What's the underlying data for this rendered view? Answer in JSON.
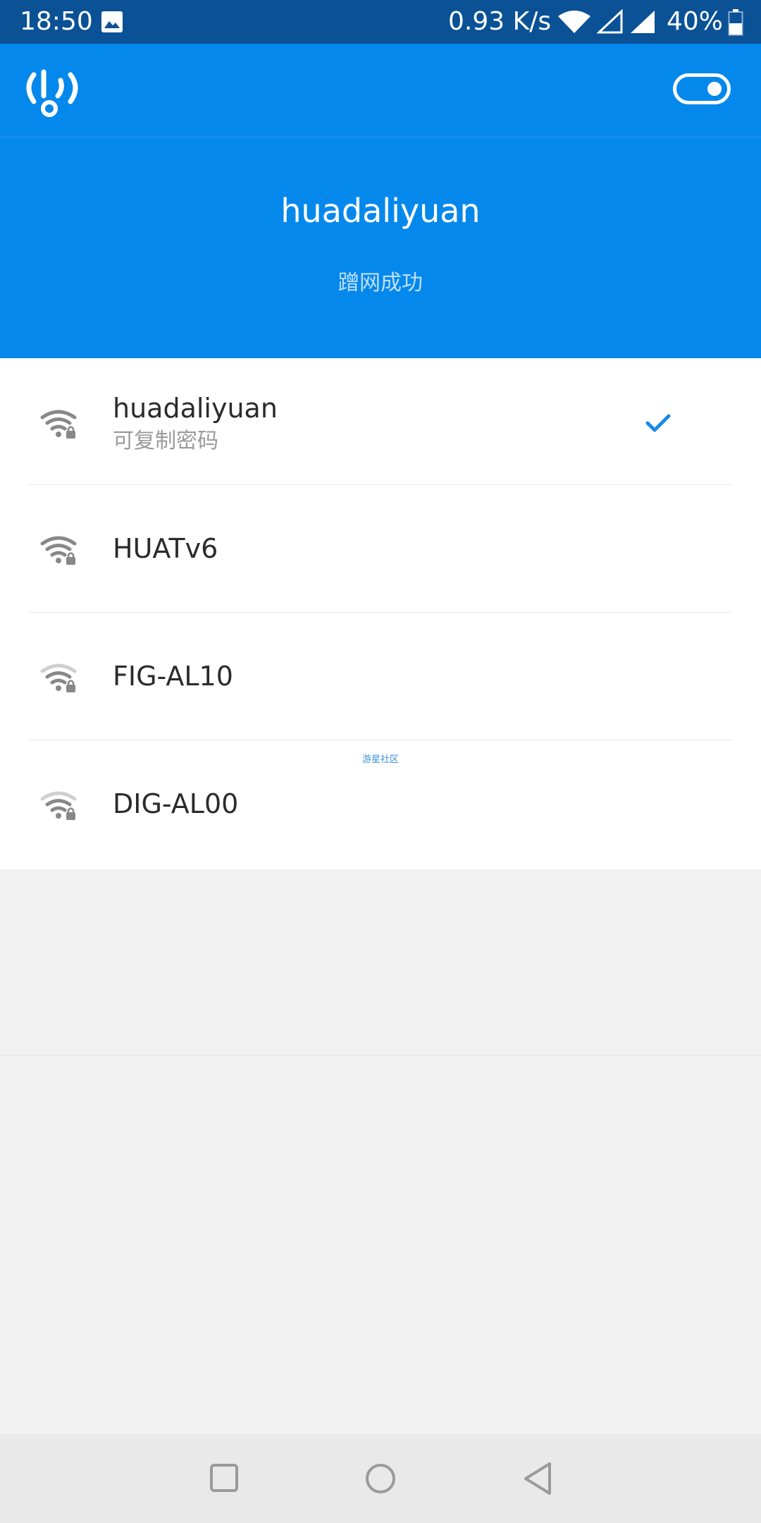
{
  "status_bar": {
    "time": "18:50",
    "net_speed": "0.93 K/s",
    "battery": "40%",
    "icons": [
      "image-icon",
      "wifi-icon",
      "cell-signal-icon",
      "cell-signal-icon",
      "battery-icon"
    ]
  },
  "header": {
    "logo_icon": "wifi-key-logo-icon",
    "toggle_icon": "toggle-icon",
    "connected_ssid": "huadaliyuan",
    "connected_status": "蹭网成功"
  },
  "networks": [
    {
      "ssid": "huadaliyuan",
      "sub": "可复制密码",
      "connected": true
    },
    {
      "ssid": "HUATv6"
    },
    {
      "ssid": "FIG-AL10"
    },
    {
      "ssid": "DIG-AL00"
    }
  ],
  "watermark": "游星社区",
  "nav": {
    "icons": [
      "recents-icon",
      "home-icon",
      "back-icon"
    ]
  },
  "colors": {
    "primary": "#0588ec",
    "status_bar": "#0a5195",
    "accent_check": "#1a8ae6"
  }
}
